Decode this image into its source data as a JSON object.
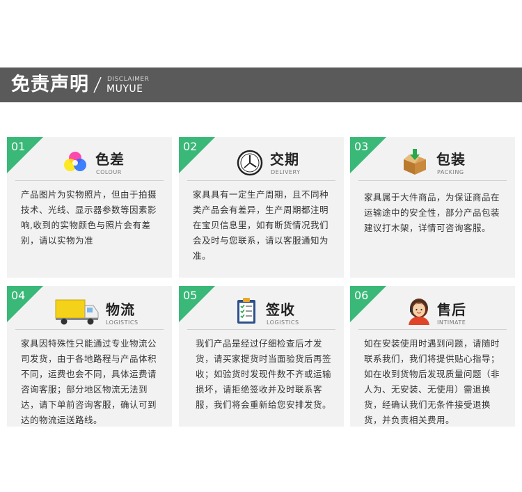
{
  "header": {
    "title": "免责声明",
    "sub1": "DISCLAIMER",
    "sub2": "MUYUE"
  },
  "cards": [
    {
      "num": "01",
      "title": "色差",
      "subtitle": "COLOUR",
      "icon": "color-circles-icon",
      "text": "产品图片为实物照片，但由于拍摄技术、光线、显示器参数等因素影响,收到的实物颜色与照片会有差别，请以实物为准"
    },
    {
      "num": "02",
      "title": "交期",
      "subtitle": "DELIVERY",
      "icon": "clock-icon",
      "text": "家具具有一定生产周期，且不同种类产品会有差异，生产周期都注明在宝贝信息里，如有断货情况我们会及时与您联系，请以客服通知为准。"
    },
    {
      "num": "03",
      "title": "包装",
      "subtitle": "PACKING",
      "icon": "box-icon",
      "text": "家具属于大件商品，为保证商品在运输途中的安全性，部分产品包装建议打木架，详情可咨询客服。"
    },
    {
      "num": "04",
      "title": "物流",
      "subtitle": "LOGISTICS",
      "icon": "truck-icon",
      "text": "家具因特殊性只能通过专业物流公司发货，由于各地路程与产品体积不同，运费也会不同，具体运费请咨询客服；部分地区物流无法到达，请下单前咨询客服，确认可到达的物流运送路线。"
    },
    {
      "num": "05",
      "title": "签收",
      "subtitle": "LOGISTICS",
      "icon": "clipboard-icon",
      "text": "我们产品是经过仔细检查后才发货，请买家提货时当面验货后再签收；如验货时发现件数不齐或运输损坏，请拒绝签收并及时联系客服，我们将会重新给您安排发货。"
    },
    {
      "num": "06",
      "title": "售后",
      "subtitle": "INTIMATE",
      "icon": "service-agent-icon",
      "text": "如在安装使用时遇到问题，请随时联系我们，我们将提供贴心指导；  如在收到货物后发现质量问题（非人为、无安装、无使用）需退换货，经确认我们无条件接受退换货，并负责相关费用。"
    }
  ],
  "colors": {
    "header_bg": "#5a5a5a",
    "accent_green": "#3ab878",
    "card_bg": "#f2f2f2"
  }
}
